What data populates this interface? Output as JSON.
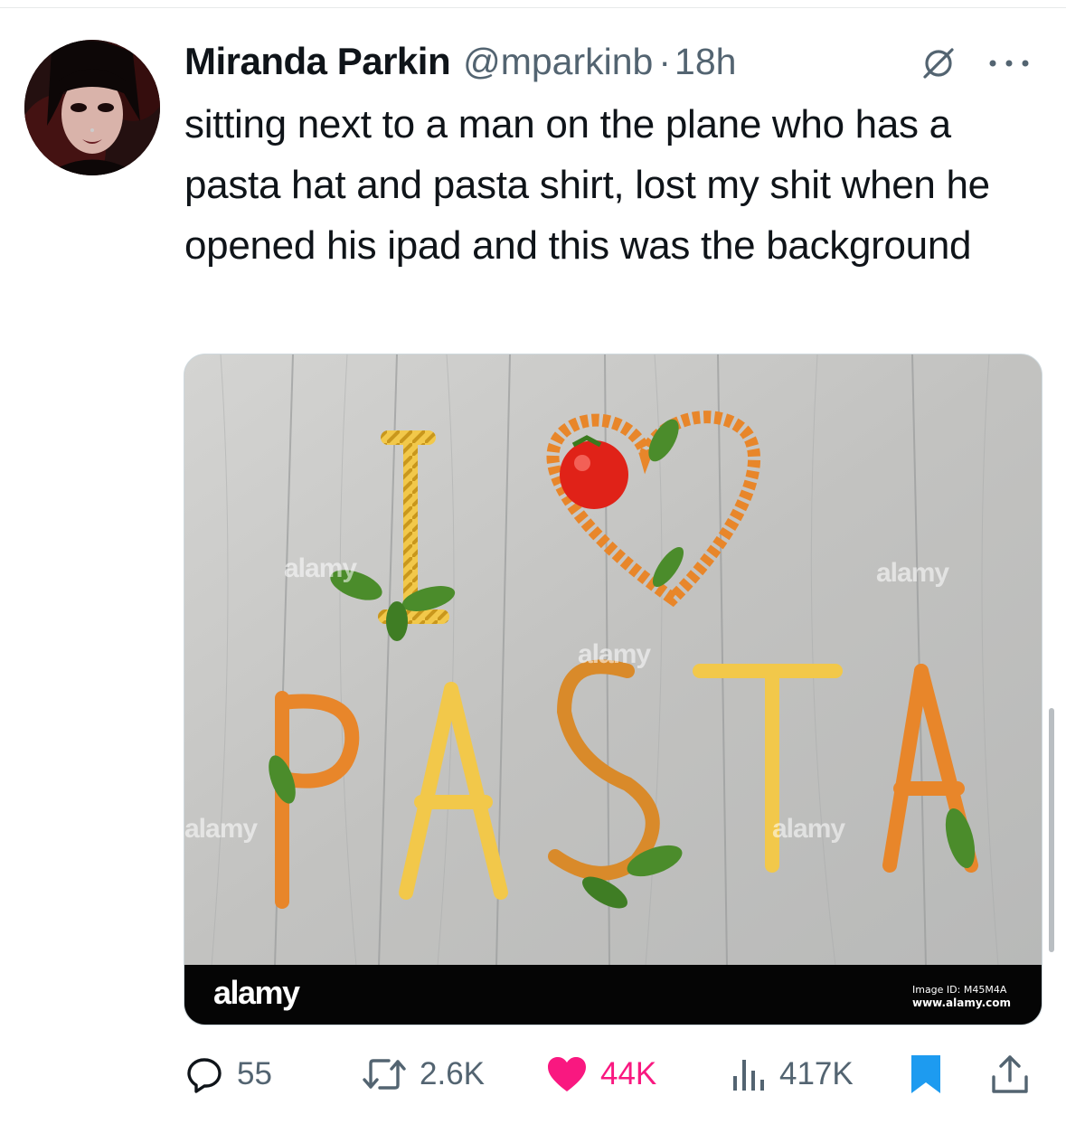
{
  "tweet": {
    "author_name": "Miranda Parkin",
    "handle": "@mparkinb",
    "separator": "·",
    "time": "18h",
    "text": "sitting next to a man on the plane who has a pasta hat and pasta shirt, lost my shit when he opened his ipad and this was the background"
  },
  "icons": {
    "muted": "muted-notifications-icon",
    "more": "more-options-icon",
    "reply": "reply-icon",
    "retweet": "retweet-icon",
    "like": "heart-icon",
    "views": "views-chart-icon",
    "bookmark": "bookmark-icon",
    "share": "share-icon"
  },
  "media": {
    "banner_logo": "alamy",
    "image_id": "Image ID: M45M4A",
    "url": "www.alamy.com",
    "watermark": "alamy"
  },
  "actions": {
    "replies": "55",
    "retweets": "2.6K",
    "likes": "44K",
    "views": "417K"
  },
  "colors": {
    "text": "#0f1419",
    "muted_text": "#536471",
    "like": "#f91880",
    "bookmark": "#1d9bf0"
  }
}
